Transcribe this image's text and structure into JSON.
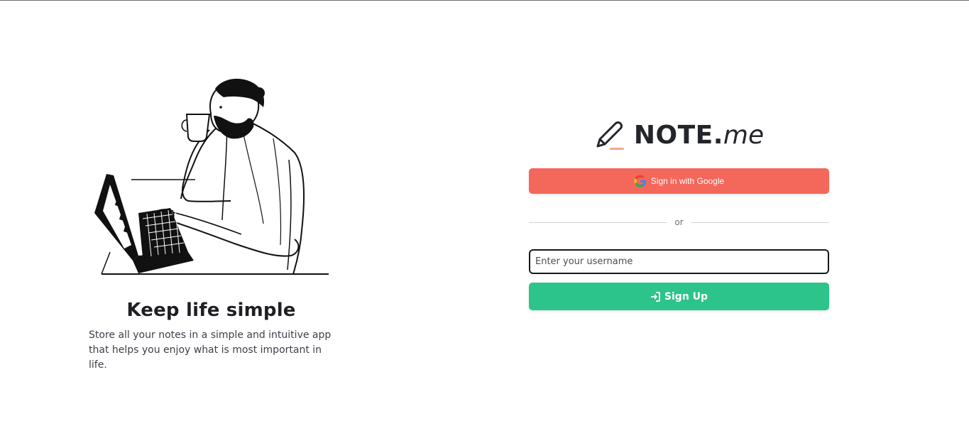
{
  "hero": {
    "title": "Keep life simple",
    "description": "Store all your notes in a simple and intuitive app that helps you enjoy what is most important in life.",
    "illustration_icon": "person-drinking-coffee-at-laptop-illustration"
  },
  "brand": {
    "name": "NOTE.",
    "suffix": "me",
    "logo_icon": "pencil-icon",
    "logo_accent": "#f7a58c"
  },
  "auth": {
    "google_button_label": "Sign in with Google",
    "google_icon": "google-g-icon",
    "divider_text": "or",
    "username_placeholder": "Enter your username",
    "username_value": "",
    "signup_label": "Sign Up",
    "signup_icon": "sign-in-icon"
  },
  "colors": {
    "google_button": "#f4675b",
    "signup_button": "#2dc48c",
    "text_dark": "#1e1f24",
    "input_border": "#15171a"
  }
}
